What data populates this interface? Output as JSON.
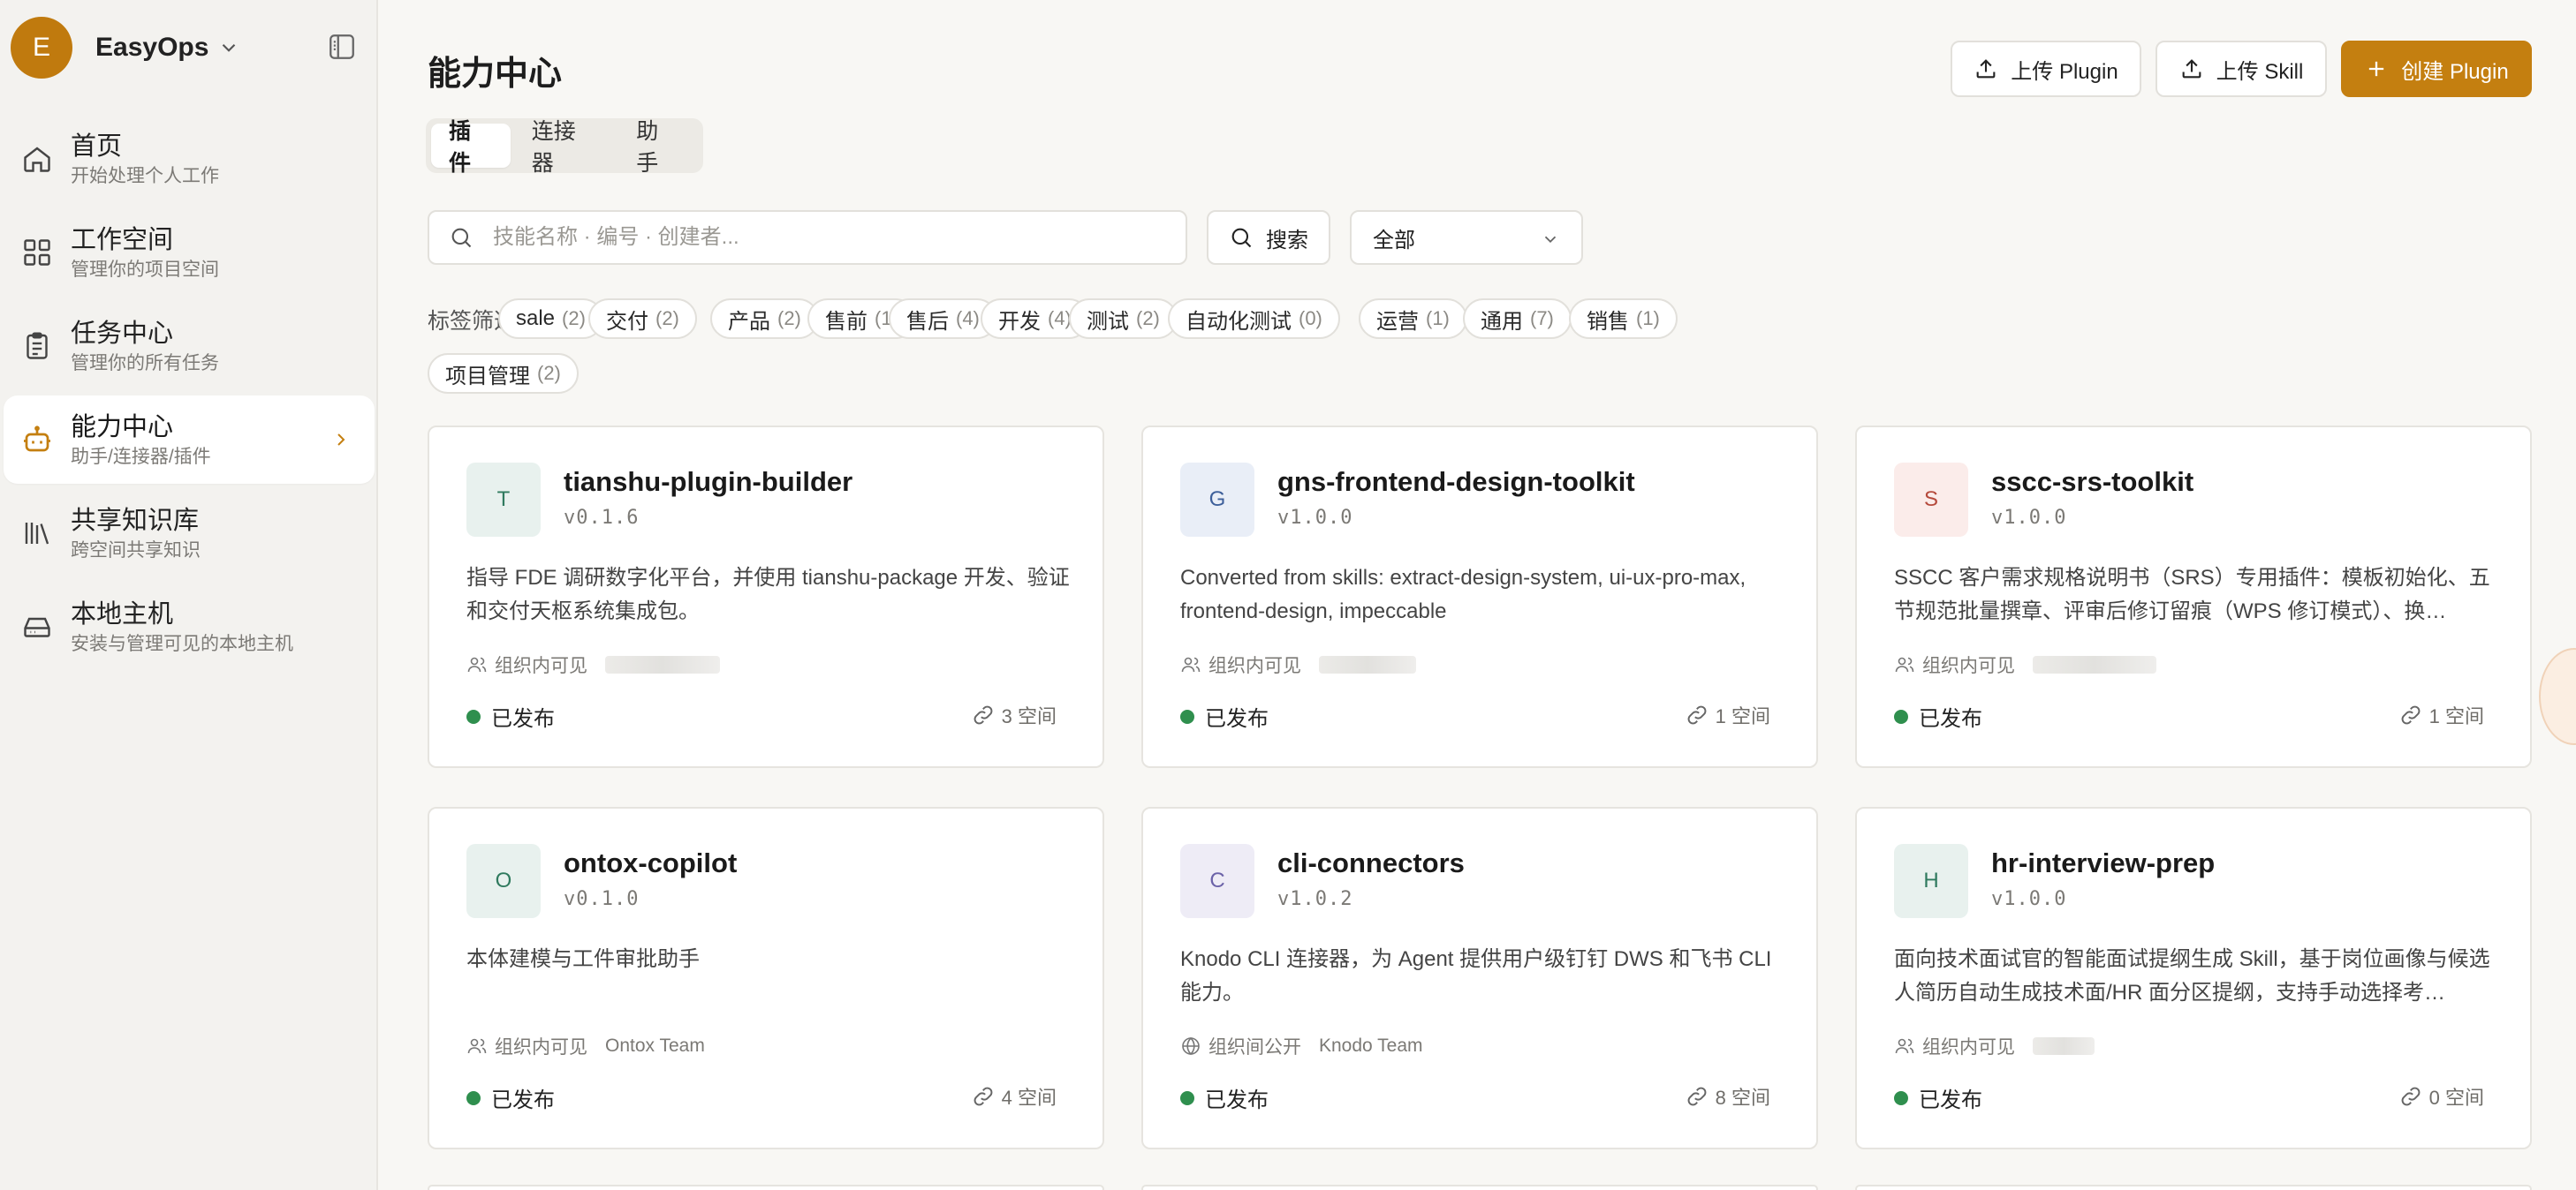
{
  "sidebar": {
    "avatar_letter": "E",
    "org_name": "EasyOps",
    "items": [
      {
        "title": "首页",
        "subtitle": "开始处理个人工作",
        "icon": "home-icon"
      },
      {
        "title": "工作空间",
        "subtitle": "管理你的项目空间",
        "icon": "grid-icon"
      },
      {
        "title": "任务中心",
        "subtitle": "管理你的所有任务",
        "icon": "clipboard-icon"
      },
      {
        "title": "能力中心",
        "subtitle": "助手/连接器/插件",
        "icon": "robot-icon",
        "active": true
      },
      {
        "title": "共享知识库",
        "subtitle": "跨空间共享知识",
        "icon": "library-icon"
      },
      {
        "title": "本地主机",
        "subtitle": "安装与管理可见的本地主机",
        "icon": "hard-drive-icon"
      }
    ]
  },
  "header": {
    "title": "能力中心",
    "upload_plugin": "上传 Plugin",
    "upload_skill": "上传 Skill",
    "create_plugin": "创建 Plugin"
  },
  "tabs": [
    {
      "label": "插件",
      "active": true
    },
    {
      "label": "连接器"
    },
    {
      "label": "助手"
    }
  ],
  "search": {
    "placeholder": "技能名称 · 编号 · 创建者...",
    "button": "搜索",
    "filter_value": "全部"
  },
  "tags": {
    "label": "标签筛选",
    "items": [
      {
        "name": "sale",
        "count": "(2)"
      },
      {
        "name": "交付",
        "count": "(2)"
      },
      {
        "name": "产品",
        "count": "(2)"
      },
      {
        "name": "售前",
        "count": "(1)"
      },
      {
        "name": "售后",
        "count": "(4)"
      },
      {
        "name": "开发",
        "count": "(4)"
      },
      {
        "name": "测试",
        "count": "(2)"
      },
      {
        "name": "自动化测试",
        "count": "(0)"
      },
      {
        "name": "运营",
        "count": "(1)"
      },
      {
        "name": "通用",
        "count": "(7)"
      },
      {
        "name": "销售",
        "count": "(1)"
      },
      {
        "name": "项目管理",
        "count": "(2)"
      }
    ]
  },
  "cards": [
    {
      "letter": "T",
      "name": "tianshu-plugin-builder",
      "version": "v0.1.6",
      "desc": "指导 FDE 调研数字化平台，并使用 tianshu-package 开发、验证和交付天枢系统集成包。",
      "visibility": "组织内可见",
      "owner": "",
      "status": "已发布",
      "spaces": "3 空间",
      "logo_bg": "#e8f1ee",
      "logo_fg": "#2f7a5e"
    },
    {
      "letter": "G",
      "name": "gns-frontend-design-toolkit",
      "version": "v1.0.0",
      "desc": "Converted from skills: extract-design-system, ui-ux-pro-max, frontend-design, impeccable",
      "visibility": "组织内可见",
      "owner": "",
      "status": "已发布",
      "spaces": "1 空间",
      "logo_bg": "#e9eef7",
      "logo_fg": "#3d5f9a"
    },
    {
      "letter": "S",
      "name": "sscc-srs-toolkit",
      "version": "v1.0.0",
      "desc": "SSCC 客户需求规格说明书（SRS）专用插件：模板初始化、五节规范批量撰章、评审后修订留痕（WPS 修订模式）、换…",
      "visibility": "组织内可见",
      "owner": "",
      "status": "已发布",
      "spaces": "1 空间",
      "logo_bg": "#fbecea",
      "logo_fg": "#b54a3c"
    },
    {
      "letter": "O",
      "name": "ontox-copilot",
      "version": "v0.1.0",
      "desc": "本体建模与工件审批助手",
      "visibility": "组织内可见",
      "owner": "Ontox Team",
      "status": "已发布",
      "spaces": "4 空间",
      "logo_bg": "#e8f1ee",
      "logo_fg": "#2f7a5e"
    },
    {
      "letter": "C",
      "name": "cli-connectors",
      "version": "v1.0.2",
      "desc": "Knodo CLI 连接器，为 Agent 提供用户级钉钉 DWS 和飞书 CLI 能力。",
      "visibility": "组织间公开",
      "owner": "Knodo Team",
      "status": "已发布",
      "spaces": "8 空间",
      "logo_bg": "#eeecf6",
      "logo_fg": "#6b62a8"
    },
    {
      "letter": "H",
      "name": "hr-interview-prep",
      "version": "v1.0.0",
      "desc": "面向技术面试官的智能面试提纲生成 Skill，基于岗位画像与候选人简历自动生成技术面/HR 面分区提纲，支持手动选择考…",
      "visibility": "组织内可见",
      "owner": "",
      "status": "已发布",
      "spaces": "0 空间",
      "logo_bg": "#e8f1ee",
      "logo_fg": "#2f7a5e"
    }
  ]
}
